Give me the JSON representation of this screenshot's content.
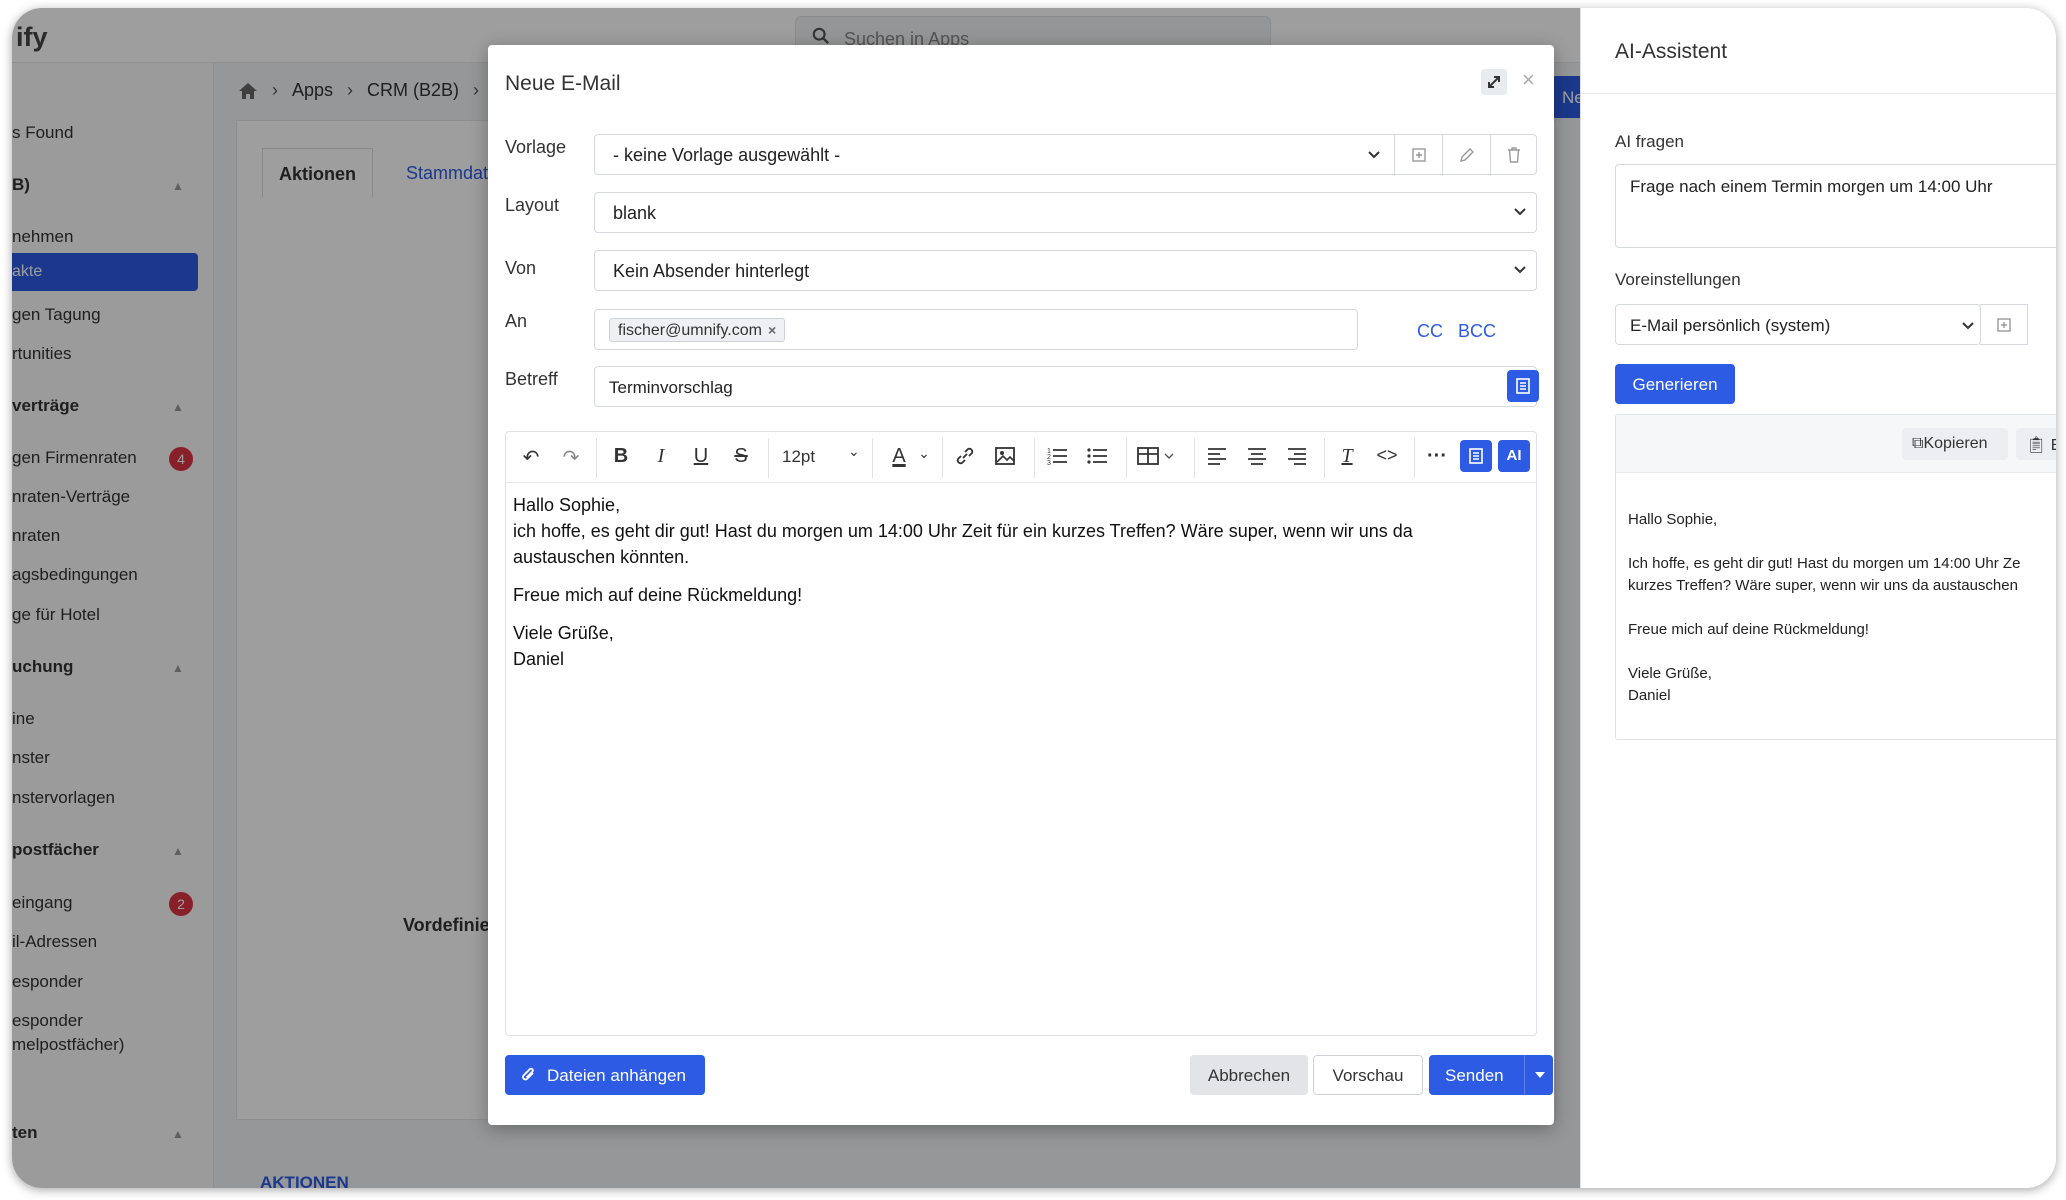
{
  "app": {
    "logo": "ify",
    "search_placeholder": "Suchen in Apps",
    "breadcrumb": [
      "Apps",
      "CRM (B2B)"
    ],
    "new_button": "Ne",
    "tabs": [
      "Aktionen",
      "Stammdaten"
    ],
    "vordef_text": "Vordefinie",
    "section_footer": "AKTIONEN"
  },
  "sidebar": {
    "items": [
      {
        "label": "s Found",
        "type": "item"
      },
      {
        "label": "B)",
        "type": "section"
      },
      {
        "label": "nehmen",
        "type": "item"
      },
      {
        "label": "akte",
        "type": "active"
      },
      {
        "label": "gen Tagung",
        "type": "item"
      },
      {
        "label": "rtunities",
        "type": "item"
      },
      {
        "label": "verträge",
        "type": "section"
      },
      {
        "label": "gen Firmenraten",
        "type": "item",
        "badge": "4"
      },
      {
        "label": "nraten-Verträge",
        "type": "item"
      },
      {
        "label": "nraten",
        "type": "item"
      },
      {
        "label": "agsbedingungen",
        "type": "item"
      },
      {
        "label": "ge für Hotel",
        "type": "item"
      },
      {
        "label": "uchung",
        "type": "section"
      },
      {
        "label": "ine",
        "type": "item"
      },
      {
        "label": "nster",
        "type": "item"
      },
      {
        "label": "nstervorlagen",
        "type": "item"
      },
      {
        "label": "postfächer",
        "type": "section"
      },
      {
        "label": "eingang",
        "type": "item",
        "badge": "2"
      },
      {
        "label": "il-Adressen",
        "type": "item"
      },
      {
        "label": "esponder",
        "type": "item"
      },
      {
        "label": "esponder",
        "type": "item"
      },
      {
        "label": "melpostfächer)",
        "type": "item"
      },
      {
        "label": "ten",
        "type": "section"
      }
    ]
  },
  "modal": {
    "title": "Neue E-Mail",
    "labels": {
      "vorlage": "Vorlage",
      "layout": "Layout",
      "von": "Von",
      "an": "An",
      "betreff": "Betreff"
    },
    "vorlage_value": "- keine Vorlage ausgewählt -",
    "layout_value": "blank",
    "von_value": "Kein Absender hinterlegt",
    "to_chip": "fischer@umnify.com",
    "cc": "CC",
    "bcc": "BCC",
    "subject": "Terminvorschlag",
    "font_size": "12pt",
    "ai_button": "AI",
    "body": {
      "line1": "Hallo Sophie,",
      "line2": "ich hoffe, es geht dir gut! Hast du morgen um 14:00 Uhr Zeit für ein kurzes Treffen? Wäre super, wenn wir uns da austauschen könnten.",
      "line3": "Freue mich auf deine Rückmeldung!",
      "line4": "Viele Grüße,",
      "line5": "Daniel"
    },
    "buttons": {
      "attach": "Dateien anhängen",
      "cancel": "Abbrechen",
      "preview": "Vorschau",
      "send": "Senden"
    }
  },
  "ai_panel": {
    "title": "AI-Assistent",
    "ask_label": "AI fragen",
    "ask_value": "Frage nach einem Termin morgen um 14:00 Uhr",
    "preset_label": "Voreinstellungen",
    "preset_value": "E-Mail persönlich (system)",
    "generate": "Generieren",
    "copy": "Kopieren",
    "insert": "Ei",
    "result": {
      "p1": "Hallo Sophie,",
      "p2": "Ich hoffe, es geht dir gut! Hast du morgen um 14:00 Uhr Ze kurzes Treffen? Wäre super, wenn wir uns da austauschen",
      "p3": "Freue mich auf deine Rückmeldung!",
      "p4a": "Viele Grüße,",
      "p4b": "Daniel"
    }
  },
  "colors": {
    "accent": "#2d5be3",
    "badge": "#dc3545"
  }
}
